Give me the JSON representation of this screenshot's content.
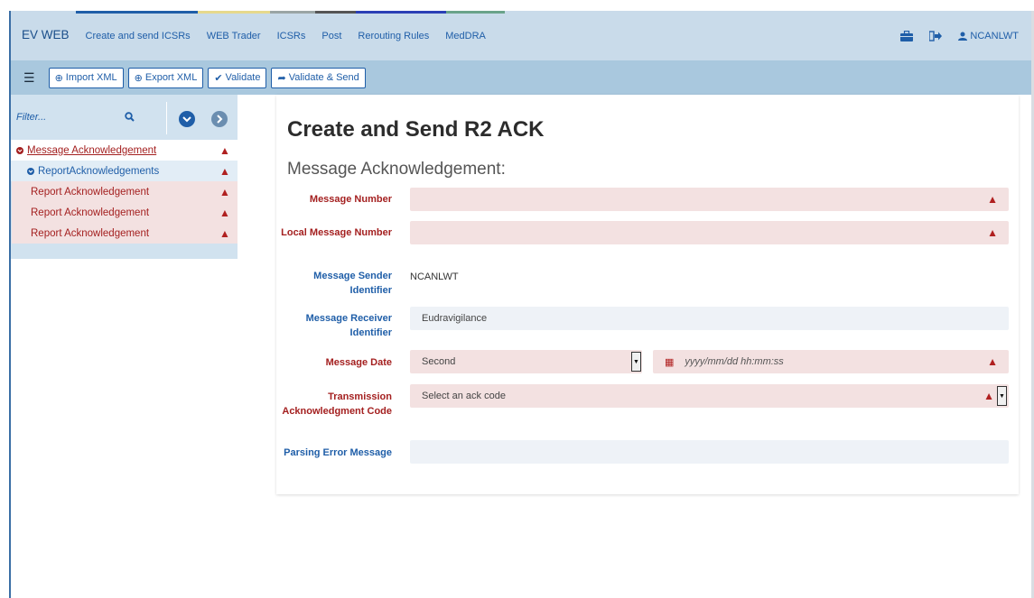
{
  "brand": "EV WEB",
  "nav": {
    "links": [
      "Create and send ICSRs",
      "WEB Trader",
      "ICSRs",
      "Post",
      "Rerouting Rules",
      "MedDRA"
    ],
    "user": "NCANLWT",
    "icons": [
      "briefcase-icon",
      "sign-out-icon",
      "user-icon"
    ]
  },
  "toolbar": {
    "menu_icon": "hamburger-icon",
    "buttons": [
      "Import XML",
      "Export XML",
      "Validate",
      "Validate & Send"
    ]
  },
  "sidebar": {
    "filter_placeholder": "Filter...",
    "tree": {
      "root": "Message Acknowledgement",
      "child": "ReportAcknowledgements",
      "leaves": [
        "Report Acknowledgement",
        "Report Acknowledgement",
        "Report Acknowledgement"
      ]
    }
  },
  "main": {
    "title": "Create and Send R2 ACK",
    "subtitle": "Message Acknowledgement:",
    "fields": {
      "message_number": {
        "label": "Message Number",
        "value": ""
      },
      "local_message_number": {
        "label": "Local Message Number",
        "value": ""
      },
      "sender": {
        "label": "Message Sender Identifier",
        "value": "NCANLWT"
      },
      "receiver": {
        "label": "Message Receiver Identifier",
        "value": "Eudravigilance"
      },
      "message_date": {
        "label": "Message Date",
        "precision": "Second",
        "placeholder": "yyyy/mm/dd hh:mm:ss"
      },
      "ack_code": {
        "label": "Transmission Acknowledgment Code",
        "placeholder": "Select an ack code"
      },
      "parsing_error": {
        "label": "Parsing Error Message",
        "value": ""
      }
    }
  },
  "colors": {
    "navbar": "#c9dbea",
    "toolbar": "#a9c8de",
    "error_bg": "#f3e1e1",
    "error_text": "#a42020",
    "link": "#1f5ea8"
  }
}
